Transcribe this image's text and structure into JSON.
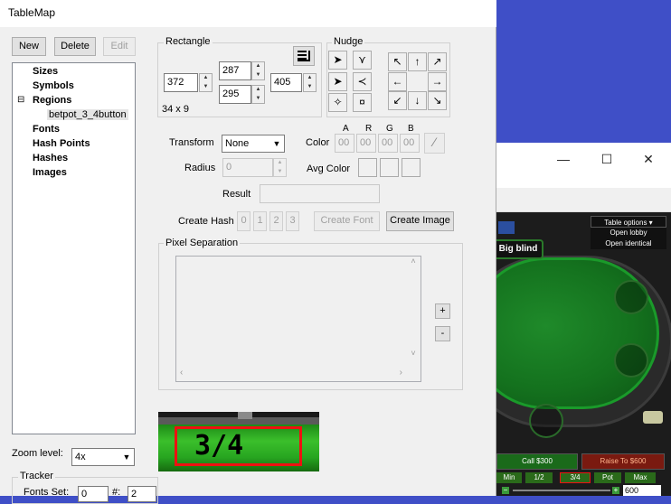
{
  "window": {
    "title": "TableMap"
  },
  "toolbar": {
    "new_label": "New",
    "delete_label": "Delete",
    "edit_label": "Edit"
  },
  "tree": {
    "items": [
      {
        "label": "Sizes"
      },
      {
        "label": "Symbols"
      },
      {
        "label": "Regions",
        "expander": "⊟"
      },
      {
        "label": "betpot_3_4button"
      },
      {
        "label": "Fonts"
      },
      {
        "label": "Hash Points"
      },
      {
        "label": "Hashes"
      },
      {
        "label": "Images"
      }
    ]
  },
  "rectangle": {
    "label": "Rectangle",
    "left": "372",
    "top": "287",
    "bottom": "295",
    "right": "405",
    "size_text": "34 x 9"
  },
  "nudge": {
    "label": "Nudge"
  },
  "transform": {
    "label": "Transform",
    "value": "None"
  },
  "radius": {
    "label": "Radius",
    "value": "0"
  },
  "color": {
    "label": "Color",
    "channels": [
      "A",
      "R",
      "G",
      "B"
    ],
    "values": [
      "00",
      "00",
      "00",
      "00"
    ]
  },
  "avg_color": {
    "label": "Avg Color"
  },
  "result": {
    "label": "Result",
    "value": ""
  },
  "create_hash": {
    "label": "Create Hash",
    "buttons": [
      "0",
      "1",
      "2",
      "3"
    ]
  },
  "create_font_label": "Create Font",
  "create_image_label": "Create Image",
  "pixel_separation": {
    "label": "Pixel Separation",
    "plus": "+",
    "minus": "-"
  },
  "preview": {
    "text": "3/4"
  },
  "zoom": {
    "label": "Zoom level:",
    "value": "4x"
  },
  "tracker": {
    "label": "Tracker",
    "fonts_set_label": "Fonts Set:",
    "fonts_set_value": "0",
    "num_label": "#:",
    "num_value": "2"
  },
  "poker": {
    "window_controls": {
      "min": "—",
      "max": "☐",
      "close": "✕"
    },
    "table_options": "Table options ▾",
    "open_lobby": "Open lobby",
    "open_identical": "Open identical",
    "big_blind": "Big blind",
    "call": "Call $300",
    "raise": "Raise To $600",
    "min": "Min",
    "half": "1/2",
    "three_quarter": "3/4",
    "pot": "Pot",
    "max": "Max",
    "bet_value": "600"
  },
  "colors": {
    "accent": "#3f4fc7",
    "felt": "#14721e",
    "highlight": "#ee1111"
  }
}
